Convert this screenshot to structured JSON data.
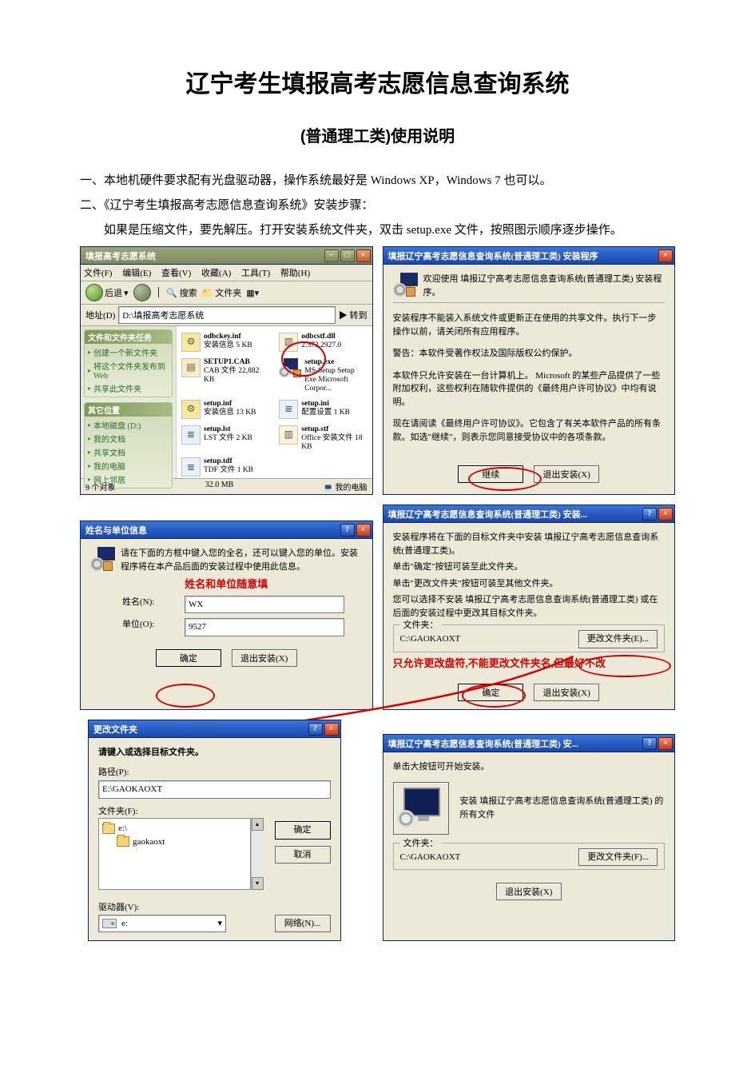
{
  "title": "辽宁考生填报高考志愿信息查询系统",
  "subtitle": "(普通理工类)使用说明",
  "para1": "一、本地机硬件要求配有光盘驱动器，操作系统最好是 Windows XP，Windows 7 也可以。",
  "para2": "二、《辽宁考生填报高考志愿信息查询系统》安装步骤：",
  "para3": "如果是压缩文件，要先解压。打开安装系统文件夹，双击 setup.exe 文件，按照图示顺序逐步操作。",
  "explorer": {
    "title": "填报高考志愿系统",
    "menu": {
      "file": "文件(F)",
      "edit": "编辑(E)",
      "view": "查看(V)",
      "fav": "收藏(A)",
      "tools": "工具(T)",
      "help": "帮助(H)"
    },
    "toolbar": {
      "back": "后退",
      "search": "搜索",
      "folders": "文件夹"
    },
    "address_label": "地址(D)",
    "address": "D:\\填报高考志愿系统",
    "go": "转到",
    "side": {
      "tasks_h": "文件和文件夹任务",
      "tasks": [
        "创建一个新文件夹",
        "将这个文件夹发布到 Web",
        "共享此文件夹"
      ],
      "other_h": "其它位置",
      "other": [
        "本地磁盘 (D:)",
        "我的文档",
        "共享文档",
        "我的电脑",
        "网上邻居"
      ]
    },
    "files": [
      {
        "name": "odbckey.inf",
        "sub": "安装信息\n5 KB"
      },
      {
        "name": "odbcstf.dll",
        "sub": "2.573.2927.0"
      },
      {
        "name": "SETUP1.CAB",
        "sub": "CAB 文件\n22,882 KB"
      },
      {
        "name": "setup.exe",
        "sub": "MS-Setup Setup Exe\nMicrosoft Corpor..."
      },
      {
        "name": "setup.inf",
        "sub": "安装信息\n13 KB"
      },
      {
        "name": "setup.ini",
        "sub": "配置设置\n1 KB"
      },
      {
        "name": "setup.lst",
        "sub": "LST 文件\n2 KB"
      },
      {
        "name": "setup.stf",
        "sub": "Office 安装文件\n18 KB"
      },
      {
        "name": "setup.tdf",
        "sub": "TDF 文件\n1 KB"
      }
    ],
    "status_left": "9 个对象",
    "status_mid": "32.0 MB",
    "status_right": "我的电脑"
  },
  "wiz1": {
    "title": "填报辽宁高考志愿信息查询系统(普通理工类) 安装程序",
    "welcome": "欢迎使用 填报辽宁高考志愿信息查询系统(普通理工类) 安装程序。",
    "warn1": "安装程序不能装入系统文件或更新正在使用的共享文件。执行下一步操作以前，请关闭所有应用程序。",
    "warn2": "警告：本软件受著作权法及国际版权公约保护。",
    "warn3": "本软件只允许安装在一台计算机上。 Microsoft 的某些产品提供了一些附加权利，这些权利在随软件提供的《最终用户许可协议》中均有说明。",
    "warn4": "现在请阅读《最终用户许可协议》。它包含了有关本软件产品的所有条款。如选\"继续\"，则表示您同意接受协议中的各项条款。",
    "btn_continue": "继续",
    "btn_exit": "退出安装(X)"
  },
  "userinfo": {
    "title": "姓名与单位信息",
    "intro": "请在下面的方框中键入您的全名，还可以键入您的单位。安装程序将在本产品后面的安装过程中使用此信息。",
    "note": "姓名和单位随意填",
    "name_lbl": "姓名(N):",
    "name_val": "WX",
    "org_lbl": "单位(O):",
    "org_val": "9527",
    "ok": "确定",
    "exit": "退出安装(X)"
  },
  "destdir": {
    "title": "填报辽宁高考志愿信息查询系统(普通理工类) 安装...",
    "l1": "安装程序将在下面的目标文件夹中安装 填报辽宁高考志愿信息查询系统(普通理工类)。",
    "l2": "单击\"确定\"按钮可装至此文件夹。",
    "l3": "单击\"更改文件夹\"按钮可装至其他文件夹。",
    "l4": "您可以选择不安装 填报辽宁高考志愿信息查询系统(普通理工类) 或在后面的安装过程中更改其目标文件夹。",
    "folder_lbl": "文件夹：",
    "folder": "C:\\GAOKAOXT",
    "change": "更改文件夹(E)...",
    "note": "只允许更改盘符,不能更改文件夹名,但最好不改",
    "ok": "确定",
    "exit": "退出安装(X)"
  },
  "changefolder": {
    "title": "更改文件夹",
    "intro": "请键入或选择目标文件夹。",
    "path_lbl": "路径(P):",
    "path": "E:\\GAOKAOXT",
    "folders_lbl": "文件夹(F):",
    "tree_root": "e:\\",
    "tree_child": "gaokaoxt",
    "drive_lbl": "驱动器(V):",
    "drive": "e:",
    "ok": "确定",
    "cancel": "取消",
    "network": "网络(N)..."
  },
  "begin": {
    "title": "填报辽宁高考志愿信息查询系统(普通理工类) 安...",
    "l1": "单击大按钮可开始安装。",
    "desc": "安装 填报辽宁高考志愿信息查询系统(普通理工类) 的所有文件",
    "folder_lbl": "文件夹：",
    "folder": "C:\\GAOKAOXT",
    "change": "更改文件夹(F)...",
    "exit": "退出安装(X)"
  },
  "tbtn": {
    "min": "−",
    "max": "□",
    "close": "×",
    "help": "?"
  }
}
